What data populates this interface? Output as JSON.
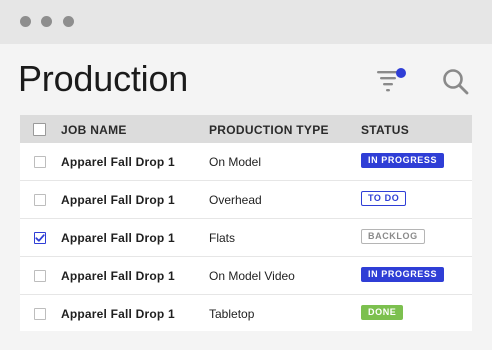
{
  "colors": {
    "accent": "#2f3ed6",
    "done": "#7cc04f",
    "titlebar": "#e6e6e6",
    "header_row": "#dcdcdc"
  },
  "window": {
    "controls": [
      "window-dot",
      "window-dot",
      "window-dot"
    ]
  },
  "page": {
    "title": "Production"
  },
  "toolbar": {
    "filter_icon": "filter-icon",
    "filter_active": true,
    "search_icon": "search-icon"
  },
  "table": {
    "columns": {
      "job": "JOB NAME",
      "type": "PRODUCTION TYPE",
      "status": "STATUS"
    },
    "rows": [
      {
        "job": "Apparel Fall Drop 1",
        "type": "On Model",
        "status": "IN PROGRESS",
        "status_kind": "in-progress",
        "checked": false
      },
      {
        "job": "Apparel Fall Drop 1",
        "type": "Overhead",
        "status": "TO DO",
        "status_kind": "todo",
        "checked": false
      },
      {
        "job": "Apparel Fall Drop 1",
        "type": "Flats",
        "status": "BACKLOG",
        "status_kind": "backlog",
        "checked": true
      },
      {
        "job": "Apparel Fall Drop 1",
        "type": "On Model Video",
        "status": "IN PROGRESS",
        "status_kind": "in-progress",
        "checked": false
      },
      {
        "job": "Apparel Fall Drop 1",
        "type": "Tabletop",
        "status": "DONE",
        "status_kind": "done",
        "checked": false
      }
    ]
  }
}
